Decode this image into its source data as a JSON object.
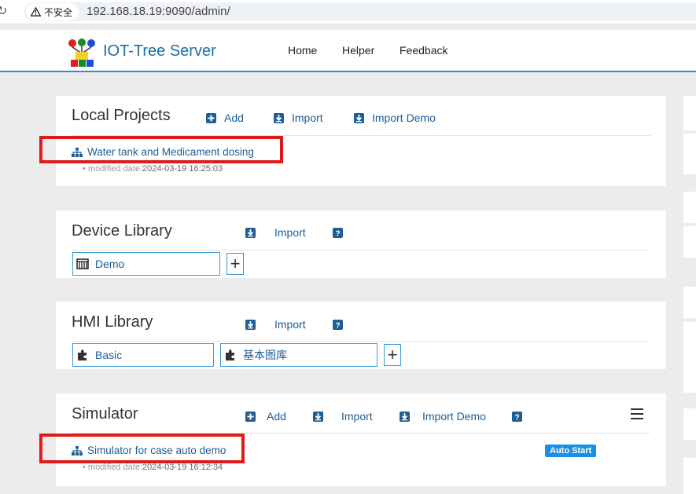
{
  "browser": {
    "secure_label": "不安全",
    "url": "192.168.18.19:9090/admin/"
  },
  "app": {
    "brand": "IOT-Tree Server",
    "nav": [
      "Home",
      "Helper",
      "Feedback"
    ]
  },
  "local_projects": {
    "title": "Local Projects",
    "actions": {
      "add": "Add",
      "import": "Import",
      "import_demo": "Import Demo"
    },
    "project": {
      "name": "Water tank and Medicament dosing",
      "modified_label": "• modified date:",
      "modified_date": "2024-03-19 16:25:03"
    }
  },
  "device_library": {
    "title": "Device Library",
    "actions": {
      "import": "Import"
    },
    "items": [
      "Demo"
    ]
  },
  "hmi_library": {
    "title": "HMI Library",
    "actions": {
      "import": "Import"
    },
    "items": [
      "Basic",
      "基本图库"
    ]
  },
  "simulator": {
    "title": "Simulator",
    "actions": {
      "add": "Add",
      "import": "Import",
      "import_demo": "Import Demo"
    },
    "instance": {
      "name": "Simulator for case auto demo",
      "badge": "Auto Start",
      "modified_label": "• modified date:",
      "modified_date": "2024-03-19 16:12:34"
    }
  },
  "colors": {
    "accent": "#1c5e95",
    "brand": "#1a6ea8",
    "highlight": "#e01b1b",
    "badge": "#1b8ee8"
  }
}
